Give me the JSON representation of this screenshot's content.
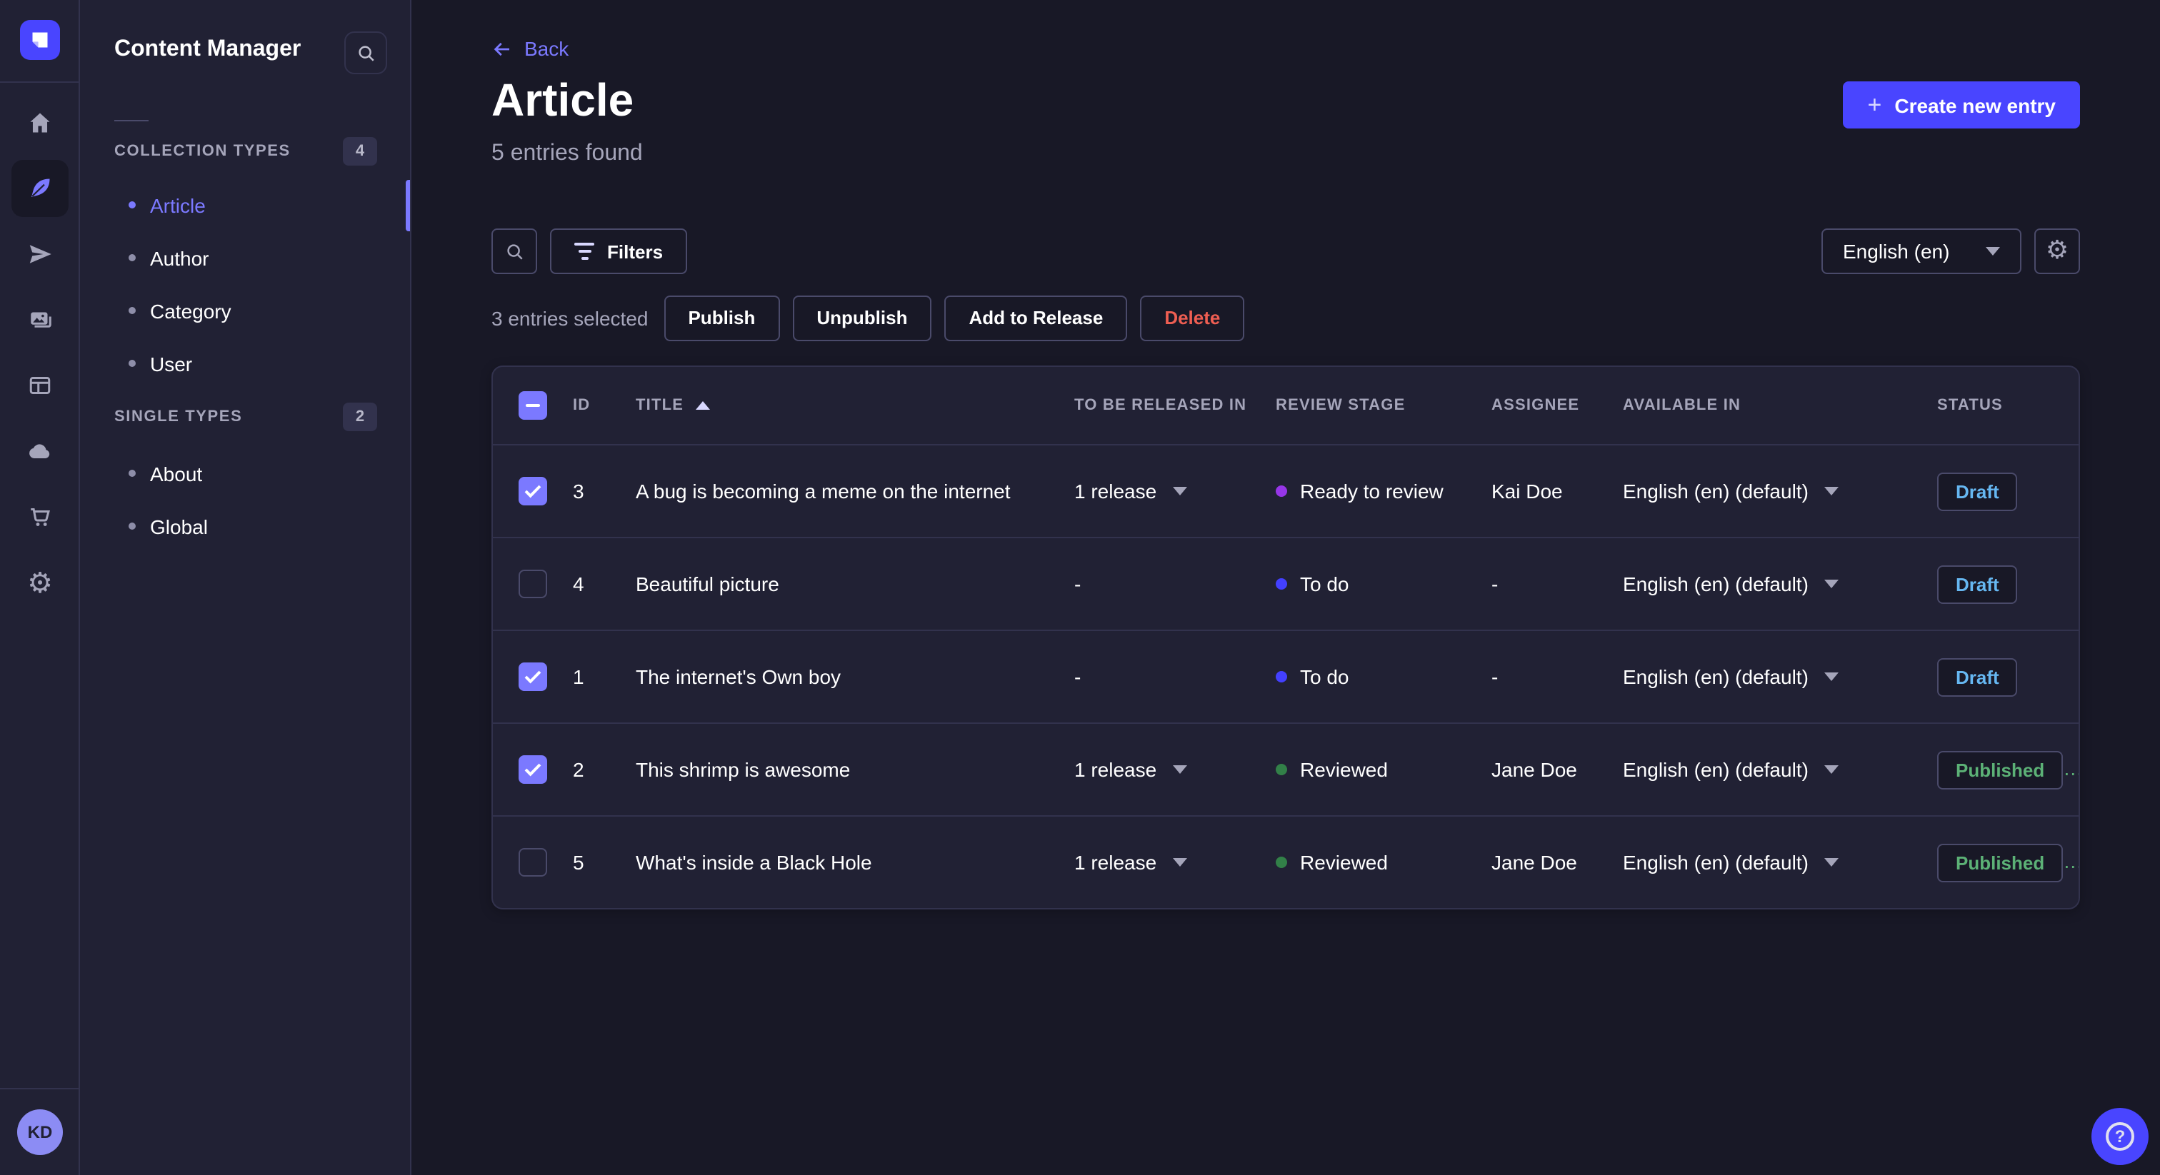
{
  "colors": {
    "background": "#181826",
    "surface": "#212134",
    "border": "#32324d",
    "border_light": "#4a4a6a",
    "primary": "#4945ff",
    "primary_light": "#7b79ff",
    "text_secondary": "#a5a5ba",
    "danger": "#ee5e52",
    "draft": "#66b7f1",
    "published": "#5cb176",
    "stage_ready_to_review": "#9736e8",
    "stage_to_do": "#4340ff",
    "stage_reviewed": "#328048",
    "avatar_bg": "#8c8cf4"
  },
  "nav_rail": {
    "icons": [
      "strapi-logo",
      "home-icon",
      "feather-icon",
      "paper-plane-icon",
      "pictures-icon",
      "layout-icon",
      "cloud-icon",
      "cart-icon",
      "gear-icon"
    ],
    "active_icon": "feather-icon",
    "avatar_initials": "KD"
  },
  "sidebar": {
    "title": "Content Manager",
    "sections": [
      {
        "label": "COLLECTION TYPES",
        "count": "4",
        "items": [
          {
            "label": "Article",
            "active": true
          },
          {
            "label": "Author"
          },
          {
            "label": "Category"
          },
          {
            "label": "User"
          }
        ]
      },
      {
        "label": "SINGLE TYPES",
        "count": "2",
        "items": [
          {
            "label": "About"
          },
          {
            "label": "Global"
          }
        ]
      }
    ]
  },
  "header": {
    "back_label": "Back",
    "title": "Article",
    "subtitle": "5 entries found",
    "create_button_label": "Create new entry"
  },
  "toolbar": {
    "filters_label": "Filters",
    "locale_value": "English (en)"
  },
  "selection": {
    "text": "3 entries selected",
    "actions": {
      "publish": "Publish",
      "unpublish": "Unpublish",
      "add_to_release": "Add to Release",
      "delete": "Delete"
    }
  },
  "table": {
    "columns": [
      "ID",
      "TITLE",
      "TO BE RELEASED IN",
      "REVIEW STAGE",
      "ASSIGNEE",
      "AVAILABLE IN",
      "STATUS"
    ],
    "sort": {
      "column": "TITLE",
      "direction": "asc"
    },
    "header_checkbox_state": "indeterminate",
    "rows": [
      {
        "selected": true,
        "id": "3",
        "title": "A bug is becoming a meme on the internet",
        "to_be_released_in": "1 release",
        "review_stage": "Ready to review",
        "assignee": "Kai Doe",
        "available_in": "English (en) (default)",
        "status": "Draft"
      },
      {
        "selected": false,
        "id": "4",
        "title": "Beautiful picture",
        "to_be_released_in": "-",
        "review_stage": "To do",
        "assignee": "-",
        "available_in": "English (en) (default)",
        "status": "Draft"
      },
      {
        "selected": true,
        "id": "1",
        "title": "The internet's Own boy",
        "to_be_released_in": "-",
        "review_stage": "To do",
        "assignee": "-",
        "available_in": "English (en) (default)",
        "status": "Draft"
      },
      {
        "selected": true,
        "id": "2",
        "title": "This shrimp is awesome",
        "to_be_released_in": "1 release",
        "review_stage": "Reviewed",
        "assignee": "Jane Doe",
        "available_in": "English (en) (default)",
        "status": "Published"
      },
      {
        "selected": false,
        "id": "5",
        "title": "What's inside a Black Hole",
        "to_be_released_in": "1 release",
        "review_stage": "Reviewed",
        "assignee": "Jane Doe",
        "available_in": "English (en) (default)",
        "status": "Published"
      }
    ]
  },
  "help": {
    "label": "?"
  }
}
